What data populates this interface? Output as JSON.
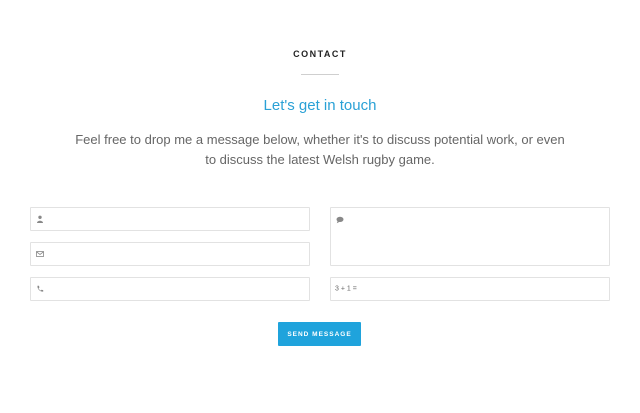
{
  "section": {
    "label": "CONTACT"
  },
  "headline": "Let's get in touch",
  "intro": "Feel free to drop me a message below, whether it's to discuss potential work, or even to discuss the latest Welsh rugby game.",
  "form": {
    "name_icon": "user-icon",
    "email_icon": "envelope-icon",
    "phone_icon": "phone-icon",
    "message_icon": "speech-bubble-icon",
    "captcha_question": "3 + 1 =",
    "send_label": "SEND MESSAGE"
  },
  "colors": {
    "accent": "#2aa1d6",
    "button": "#1fa3dc",
    "border": "#e2e2e2"
  }
}
